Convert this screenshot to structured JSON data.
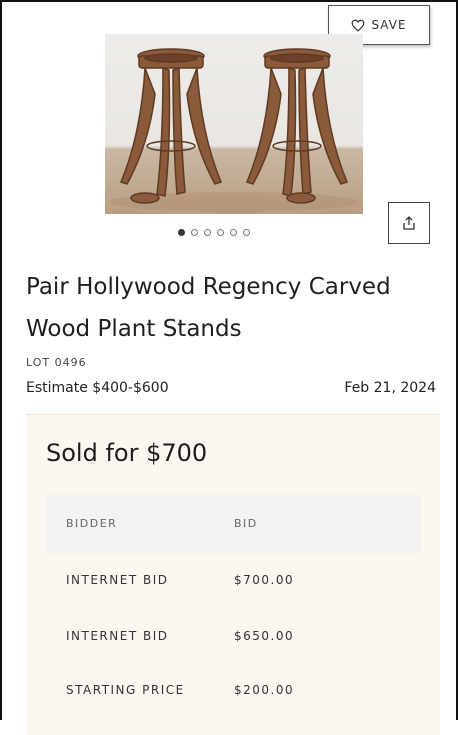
{
  "save": {
    "label": "SAVE",
    "icon": "heart-icon"
  },
  "gallery": {
    "image_count": 6,
    "active_index": 0,
    "share_icon": "share-icon"
  },
  "lot": {
    "title": "Pair Hollywood Regency Carved Wood Plant Stands",
    "number": "LOT 0496",
    "estimate": "Estimate $400-$600",
    "date": "Feb 21, 2024"
  },
  "result": {
    "sold_text": "Sold for $700",
    "columns": [
      "BIDDER",
      "BID"
    ],
    "bids": [
      {
        "bidder": "INTERNET BID",
        "amount": "$700.00"
      },
      {
        "bidder": "INTERNET BID",
        "amount": "$650.00"
      },
      {
        "bidder": "STARTING PRICE",
        "amount": "$200.00"
      }
    ]
  },
  "colors": {
    "panel_bg": "#fdf7f2",
    "header_bg": "#f3f2f1",
    "text": "#1d1d1d"
  }
}
